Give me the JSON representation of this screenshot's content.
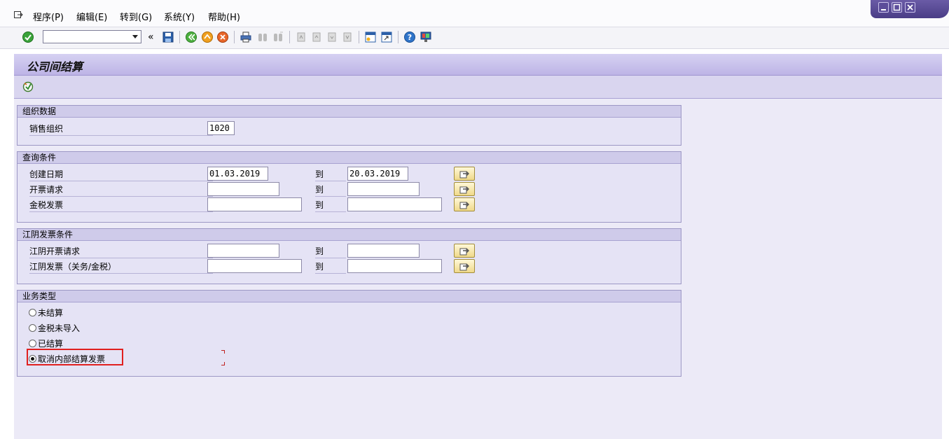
{
  "menu": {
    "items": [
      "程序(P)",
      "编辑(E)",
      "转到(G)",
      "系统(Y)",
      "帮助(H)"
    ]
  },
  "toolbar": {
    "command_value": "",
    "back_label": "«"
  },
  "screen": {
    "title": "公司间结算"
  },
  "org": {
    "header": "组织数据",
    "sales_org_label": "销售组织",
    "sales_org_value": "1020"
  },
  "query": {
    "header": "查询条件",
    "rows": [
      {
        "label": "创建日期",
        "from": "01.03.2019",
        "to_label": "到",
        "to": "20.03.2019"
      },
      {
        "label": "开票请求",
        "from": "",
        "to_label": "到",
        "to": ""
      },
      {
        "label": "金税发票",
        "from": "",
        "to_label": "到",
        "to": ""
      }
    ]
  },
  "jiangyin": {
    "header": "江阴发票条件",
    "rows": [
      {
        "label": "江阴开票请求",
        "from": "",
        "to_label": "到",
        "to": ""
      },
      {
        "label": "江阴发票（关务/金税）",
        "from": "",
        "to_label": "到",
        "to": ""
      }
    ]
  },
  "biz": {
    "header": "业务类型",
    "options": [
      {
        "label": "未结算",
        "selected": false
      },
      {
        "label": "金税未导入",
        "selected": false
      },
      {
        "label": "已结算",
        "selected": false
      },
      {
        "label": "取消内部结算发票",
        "selected": true
      }
    ]
  },
  "colors": {
    "title_bar": "#c9c2ec",
    "group_header": "#cfcbea",
    "highlight": "#e0201f",
    "window_controls": "#5c4d9a"
  }
}
